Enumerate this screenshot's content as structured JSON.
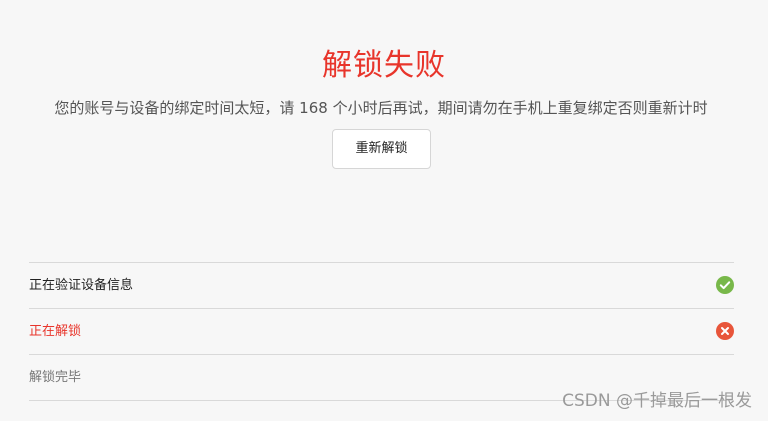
{
  "result": {
    "title": "解锁失败",
    "message": "您的账号与设备的绑定时间太短，请 168 个小时后再试，期间请勿在手机上重复绑定否则重新计时",
    "retry_label": "重新解锁"
  },
  "steps": [
    {
      "label": "正在验证设备信息",
      "status": "done",
      "icon": "check-circle-icon",
      "color": "#78b84a"
    },
    {
      "label": "正在解锁",
      "status": "error",
      "icon": "close-circle-icon",
      "color": "#e8553a"
    },
    {
      "label": "解锁完毕",
      "status": "pending"
    }
  ],
  "watermark": "CSDN @千掉最后一根发",
  "colors": {
    "error": "#e8352b",
    "success": "#78b84a",
    "background": "#f7f7f7"
  }
}
